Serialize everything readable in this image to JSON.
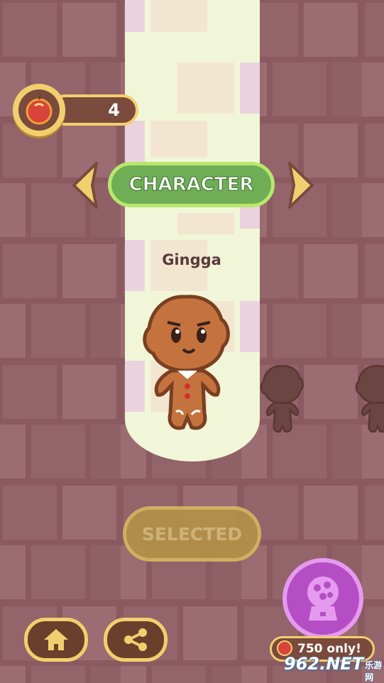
{
  "coins": {
    "count": "4",
    "icon": "apple-coin-icon"
  },
  "header": {
    "label": "CHARACTER"
  },
  "character": {
    "name": "Gingga"
  },
  "actions": {
    "selected_label": "SELECTED",
    "price_label": "750 only!"
  },
  "watermark": {
    "brand": "962.NET",
    "sub": "乐游网"
  },
  "colors": {
    "accent_green": "#6fae55",
    "gold": "#f2cf6e",
    "purple": "#b54ec4"
  }
}
